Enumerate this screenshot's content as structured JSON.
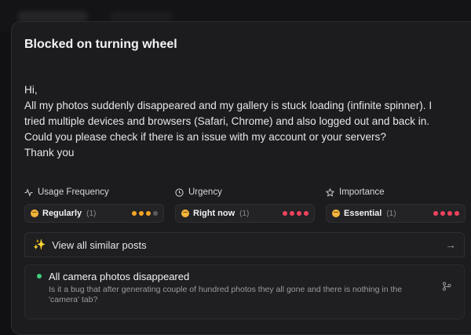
{
  "ticket": {
    "title": "Blocked on turning wheel",
    "message_lines": [
      "Hi,",
      "All my photos suddenly disappeared and my gallery is stuck loading (infinite spinner). I",
      "tried multiple devices and browsers (Safari, Chrome) and also logged out and back in.",
      "Could you please check if there is an issue with my account or your servers?",
      "Thank you"
    ]
  },
  "attributes": [
    {
      "heading": "Usage Frequency",
      "icon": "activity-icon",
      "value": "Regularly",
      "count": "(1)",
      "level": 3,
      "dot_color": "#f5a524",
      "empty_color": "#5a5a60"
    },
    {
      "heading": "Urgency",
      "icon": "clock-icon",
      "value": "Right now",
      "count": "(1)",
      "level": 4,
      "dot_color": "#f0425e",
      "empty_color": "#5a5a60"
    },
    {
      "heading": "Importance",
      "icon": "star-icon",
      "value": "Essential",
      "count": "(1)",
      "level": 4,
      "dot_color": "#f0425e",
      "empty_color": "#5a5a60"
    }
  ],
  "similar": {
    "label": "View all similar posts",
    "icon": "sparkle-icon",
    "arrow_icon": "arrow-right-icon"
  },
  "similar_posts": [
    {
      "title": "All camera photos disappeared",
      "description": "Is it a bug that after generating couple of hundred photos they all gone and there is nothing in the 'camera' tab?",
      "status_color": "#3fd07a",
      "icon": "branch-icon"
    }
  ]
}
